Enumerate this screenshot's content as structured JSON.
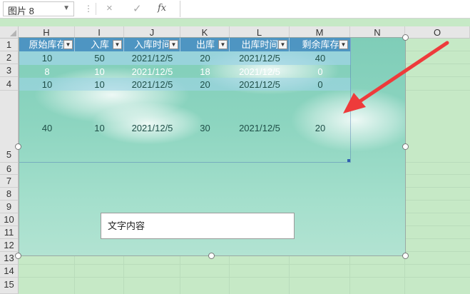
{
  "formula_bar": {
    "name_box": "图片 8",
    "cancel_icon": "×",
    "confirm_icon": "✓",
    "fx_icon": "fx",
    "formula_value": ""
  },
  "columns": [
    "H",
    "I",
    "J",
    "K",
    "L",
    "M",
    "N",
    "O"
  ],
  "rows": [
    "1",
    "2",
    "3",
    "4",
    "5",
    "6",
    "7",
    "8",
    "9",
    "10",
    "11",
    "12",
    "13",
    "14",
    "15"
  ],
  "table": {
    "headers": [
      "原始库存",
      "入库",
      "入库时间",
      "出库",
      "出库时间",
      "剩余库存"
    ],
    "filter_icon": "▼",
    "rows": [
      [
        "10",
        "50",
        "2021/12/5",
        "20",
        "2021/12/5",
        "40"
      ],
      [
        "8",
        "10",
        "2021/12/5",
        "18",
        "2021/12/5",
        "0"
      ],
      [
        "10",
        "10",
        "2021/12/5",
        "20",
        "2021/12/5",
        "0"
      ],
      [
        "40",
        "10",
        "2021/12/5",
        "30",
        "2021/12/5",
        "20"
      ]
    ]
  },
  "textbox": {
    "text": "文字内容"
  },
  "colors": {
    "header_band": "#4a90c2",
    "row_band": "#9fd4e6",
    "picture_top": "#7fcdb8",
    "picture_bottom": "#b2e3d2",
    "arrow": "#ee3b3b",
    "sheet_bg": "#c6e9c6"
  }
}
